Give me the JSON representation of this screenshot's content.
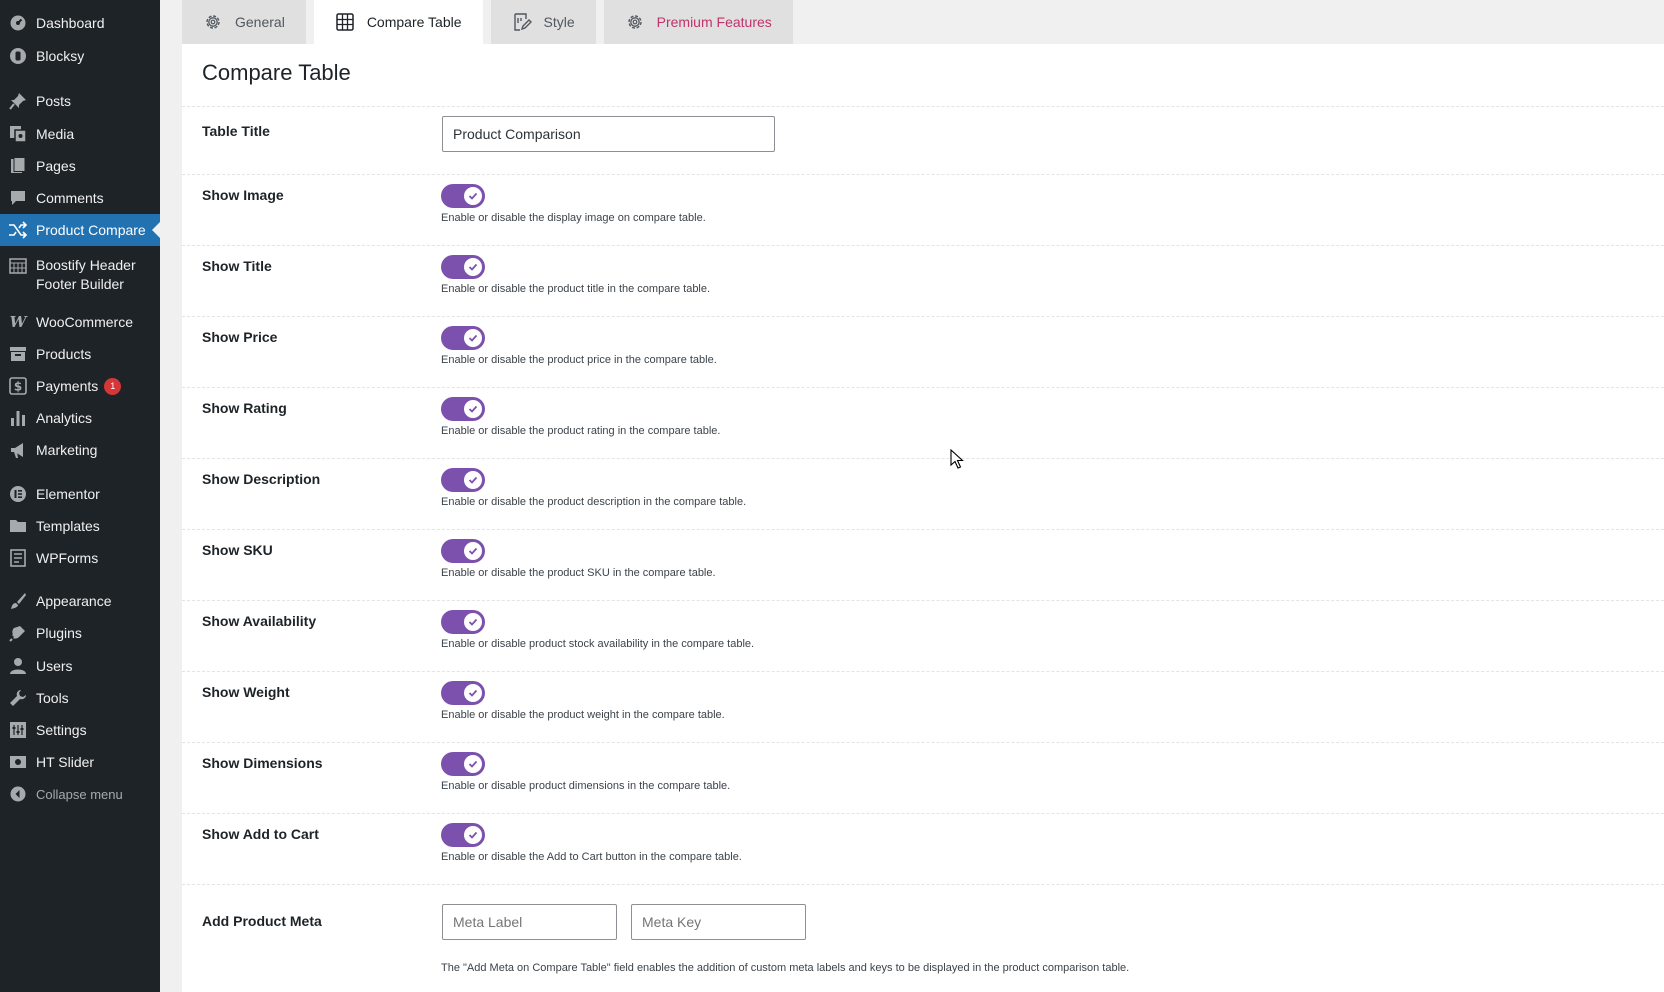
{
  "sidebar": {
    "items": [
      {
        "label": "Dashboard",
        "icon": "dashboard-icon"
      },
      {
        "label": "Blocksy",
        "icon": "blocksy-icon"
      },
      {
        "label": "Posts",
        "icon": "pushpin-icon"
      },
      {
        "label": "Media",
        "icon": "media-icon"
      },
      {
        "label": "Pages",
        "icon": "pages-icon"
      },
      {
        "label": "Comments",
        "icon": "comment-icon"
      },
      {
        "label": "Product Compare",
        "icon": "shuffle-icon",
        "active": true
      },
      {
        "label": "Boostify Header Footer Builder",
        "icon": "grid-icon"
      },
      {
        "label": "WooCommerce",
        "icon": "woo-icon"
      },
      {
        "label": "Products",
        "icon": "archive-icon"
      },
      {
        "label": "Payments",
        "icon": "dollar-icon",
        "badge": "1"
      },
      {
        "label": "Analytics",
        "icon": "bar-chart-icon"
      },
      {
        "label": "Marketing",
        "icon": "megaphone-icon"
      },
      {
        "label": "Elementor",
        "icon": "elementor-icon"
      },
      {
        "label": "Templates",
        "icon": "folder-icon"
      },
      {
        "label": "WPForms",
        "icon": "forms-icon"
      },
      {
        "label": "Appearance",
        "icon": "brush-icon"
      },
      {
        "label": "Plugins",
        "icon": "plug-icon"
      },
      {
        "label": "Users",
        "icon": "user-icon"
      },
      {
        "label": "Tools",
        "icon": "wrench-icon"
      },
      {
        "label": "Settings",
        "icon": "settings-icon"
      },
      {
        "label": "HT Slider",
        "icon": "slider-icon"
      },
      {
        "label": "Collapse menu",
        "icon": "collapse-icon"
      }
    ]
  },
  "tabs": [
    {
      "label": "General",
      "icon": "gear-icon"
    },
    {
      "label": "Compare Table",
      "icon": "table-icon",
      "active": true
    },
    {
      "label": "Style",
      "icon": "style-icon"
    },
    {
      "label": "Premium Features",
      "icon": "gear-icon"
    }
  ],
  "page": {
    "title": "Compare Table",
    "table_title_label": "Table Title",
    "table_title_value": "Product Comparison",
    "toggles": [
      {
        "label": "Show Image",
        "description": "Enable or disable the display image on compare table.",
        "enabled": true
      },
      {
        "label": "Show Title",
        "description": "Enable or disable the product title in the compare table.",
        "enabled": true
      },
      {
        "label": "Show Price",
        "description": "Enable or disable the product price in the compare table.",
        "enabled": true
      },
      {
        "label": "Show Rating",
        "description": "Enable or disable the product rating in the compare table.",
        "enabled": true
      },
      {
        "label": "Show Description",
        "description": "Enable or disable the product description in the compare table.",
        "enabled": true
      },
      {
        "label": "Show SKU",
        "description": "Enable or disable the product SKU in the compare table.",
        "enabled": true
      },
      {
        "label": "Show Availability",
        "description": "Enable or disable product stock availability in the compare table.",
        "enabled": true
      },
      {
        "label": "Show Weight",
        "description": "Enable or disable the product weight in the compare table.",
        "enabled": true
      },
      {
        "label": "Show Dimensions",
        "description": "Enable or disable product dimensions in the compare table.",
        "enabled": true
      },
      {
        "label": "Show Add to Cart",
        "description": "Enable or disable the Add to Cart button in the compare table.",
        "enabled": true
      }
    ],
    "product_meta": {
      "label": "Add Product Meta",
      "meta_label_placeholder": "Meta Label",
      "meta_key_placeholder": "Meta Key",
      "description": "The \"Add Meta on Compare Table\" field enables the addition of custom meta labels and keys to be displayed in the product comparison table."
    }
  },
  "colors": {
    "sidebar_bg": "#1d2327",
    "active_menu": "#2271b1",
    "toggle_on": "#7b51ad",
    "premium_tab": "#c0336b",
    "badge": "#d63638"
  }
}
